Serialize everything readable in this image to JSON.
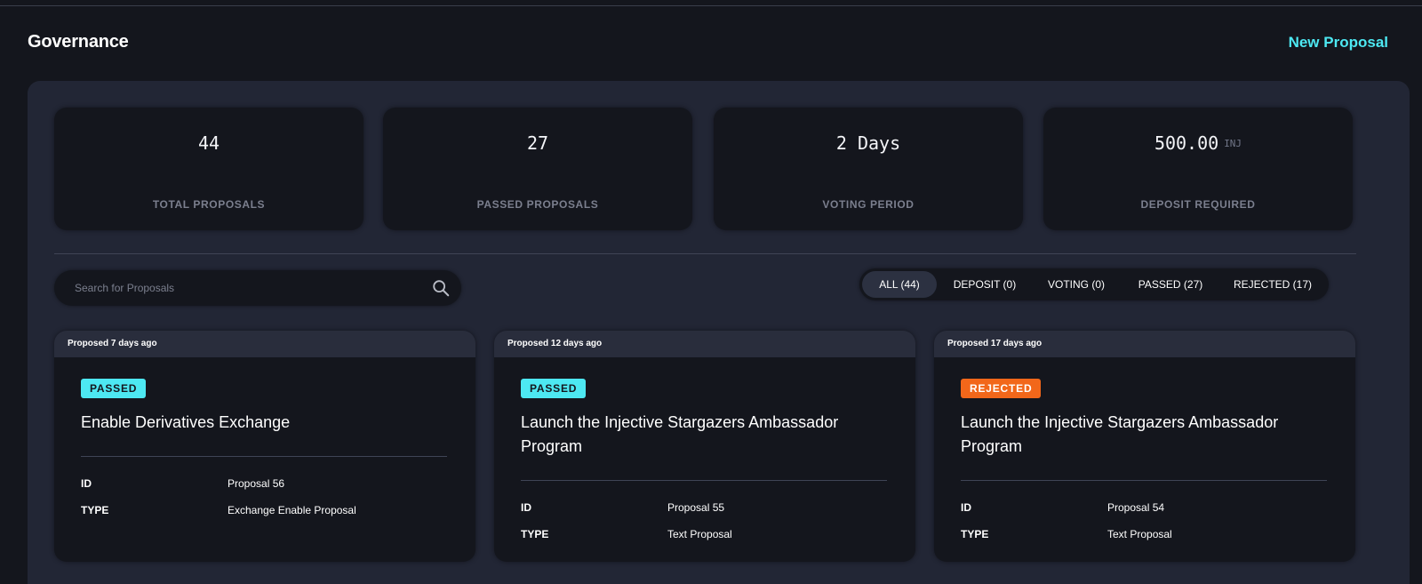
{
  "header": {
    "title": "Governance",
    "new_proposal_label": "New Proposal",
    "accent_color": "#4de8f2"
  },
  "stats": [
    {
      "value": "44",
      "unit": "",
      "label": "TOTAL PROPOSALS"
    },
    {
      "value": "27",
      "unit": "",
      "label": "PASSED PROPOSALS"
    },
    {
      "value": "2 Days",
      "unit": "",
      "label": "VOTING PERIOD"
    },
    {
      "value": "500.00",
      "unit": "INJ",
      "label": "DEPOSIT REQUIRED"
    }
  ],
  "search": {
    "placeholder": "Search for Proposals",
    "value": ""
  },
  "filters": [
    {
      "label": "ALL (44)",
      "active": true
    },
    {
      "label": "DEPOSIT (0)",
      "active": false
    },
    {
      "label": "VOTING (0)",
      "active": false
    },
    {
      "label": "PASSED (27)",
      "active": false
    },
    {
      "label": "REJECTED (17)",
      "active": false
    }
  ],
  "proposals": [
    {
      "proposed": "Proposed 7 days ago",
      "status": "PASSED",
      "title": "Enable Derivatives Exchange",
      "id_label": "ID",
      "id_value": "Proposal 56",
      "type_label": "TYPE",
      "type_value": "Exchange Enable Proposal"
    },
    {
      "proposed": "Proposed 12 days ago",
      "status": "PASSED",
      "title": "Launch the Injective Stargazers Ambassador Program",
      "id_label": "ID",
      "id_value": "Proposal 55",
      "type_label": "TYPE",
      "type_value": "Text Proposal"
    },
    {
      "proposed": "Proposed 17 days ago",
      "status": "REJECTED",
      "title": "Launch the Injective Stargazers Ambassador Program",
      "id_label": "ID",
      "id_value": "Proposal 54",
      "type_label": "TYPE",
      "type_value": "Text Proposal"
    }
  ],
  "colors": {
    "background": "#14161d",
    "panel": "#222635",
    "passed": "#4de8f2",
    "rejected": "#f2671a"
  }
}
